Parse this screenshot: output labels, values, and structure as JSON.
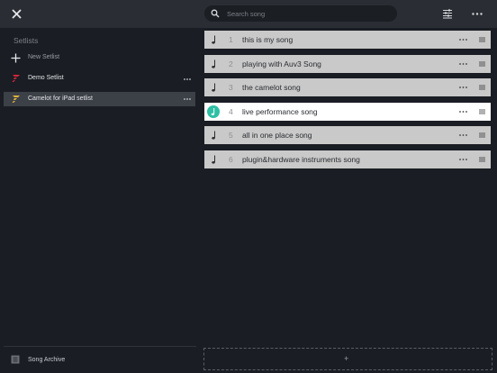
{
  "header": {
    "search_placeholder": "Search song"
  },
  "sidebar": {
    "title": "Setlists",
    "new_setlist_label": "New Setlist",
    "setlists": [
      {
        "label": "Demo Setlist",
        "icon_color": "#d7263d",
        "selected": false
      },
      {
        "label": "Camelot for iPad setlist",
        "icon_color": "#e0b43b",
        "selected": true
      }
    ],
    "archive_label": "Song Archive"
  },
  "songs": [
    {
      "number": "1",
      "title": "this is my song",
      "active": false
    },
    {
      "number": "2",
      "title": "playing with Auv3 Song",
      "active": false
    },
    {
      "number": "3",
      "title": "the camelot song",
      "active": false
    },
    {
      "number": "4",
      "title": "live performance song",
      "active": true
    },
    {
      "number": "5",
      "title": "all in one place song",
      "active": false
    },
    {
      "number": "6",
      "title": "plugin&hardware instruments song",
      "active": false
    }
  ],
  "add_button_label": "+",
  "colors": {
    "accent": "#2ebfa5",
    "demo_setlist_icon": "#d7263d",
    "camelot_setlist_icon": "#e0b43b"
  }
}
